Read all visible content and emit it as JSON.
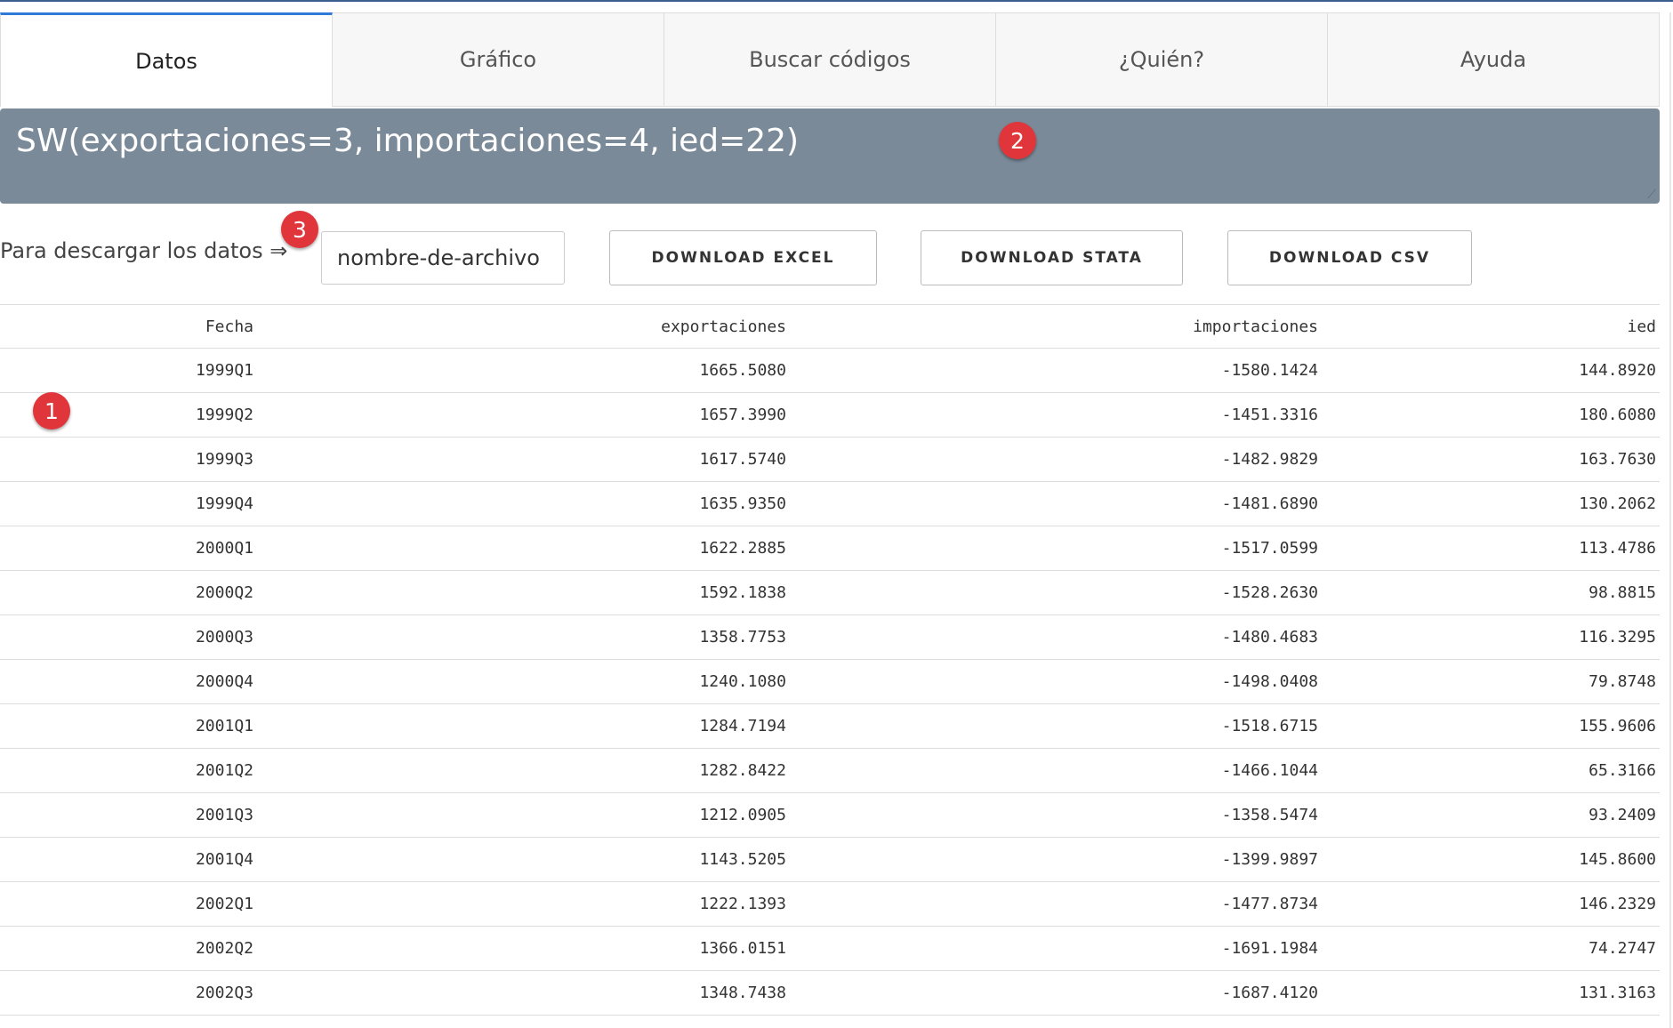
{
  "tabs": [
    {
      "label": "Datos",
      "active": true
    },
    {
      "label": "Gráfico",
      "active": false
    },
    {
      "label": "Buscar códigos",
      "active": false
    },
    {
      "label": "¿Quién?",
      "active": false
    },
    {
      "label": "Ayuda",
      "active": false
    }
  ],
  "formula": {
    "text": "SW(exportaciones=3, importaciones=4, ied=22)"
  },
  "download": {
    "label": "Para descargar los datos ⇒",
    "filename_value": "nombre-de-archivo",
    "excel_label": "DOWNLOAD EXCEL",
    "stata_label": "DOWNLOAD STATA",
    "csv_label": "DOWNLOAD CSV"
  },
  "table": {
    "headers": [
      "Fecha",
      "exportaciones",
      "importaciones",
      "ied"
    ],
    "rows": [
      [
        "1999Q1",
        "1665.5080",
        "-1580.1424",
        "144.8920"
      ],
      [
        "1999Q2",
        "1657.3990",
        "-1451.3316",
        "180.6080"
      ],
      [
        "1999Q3",
        "1617.5740",
        "-1482.9829",
        "163.7630"
      ],
      [
        "1999Q4",
        "1635.9350",
        "-1481.6890",
        "130.2062"
      ],
      [
        "2000Q1",
        "1622.2885",
        "-1517.0599",
        "113.4786"
      ],
      [
        "2000Q2",
        "1592.1838",
        "-1528.2630",
        "98.8815"
      ],
      [
        "2000Q3",
        "1358.7753",
        "-1480.4683",
        "116.3295"
      ],
      [
        "2000Q4",
        "1240.1080",
        "-1498.0408",
        "79.8748"
      ],
      [
        "2001Q1",
        "1284.7194",
        "-1518.6715",
        "155.9606"
      ],
      [
        "2001Q2",
        "1282.8422",
        "-1466.1044",
        "65.3166"
      ],
      [
        "2001Q3",
        "1212.0905",
        "-1358.5474",
        "93.2409"
      ],
      [
        "2001Q4",
        "1143.5205",
        "-1399.9897",
        "145.8600"
      ],
      [
        "2002Q1",
        "1222.1393",
        "-1477.8734",
        "146.2329"
      ],
      [
        "2002Q2",
        "1366.0151",
        "-1691.1984",
        "74.2747"
      ],
      [
        "2002Q3",
        "1348.7438",
        "-1687.4120",
        "131.3163"
      ]
    ]
  },
  "badges": [
    "1",
    "2",
    "3"
  ],
  "colors": {
    "accent": "#2f7ad6",
    "formula_bg": "#7a8a99",
    "badge": "#e0363b"
  }
}
